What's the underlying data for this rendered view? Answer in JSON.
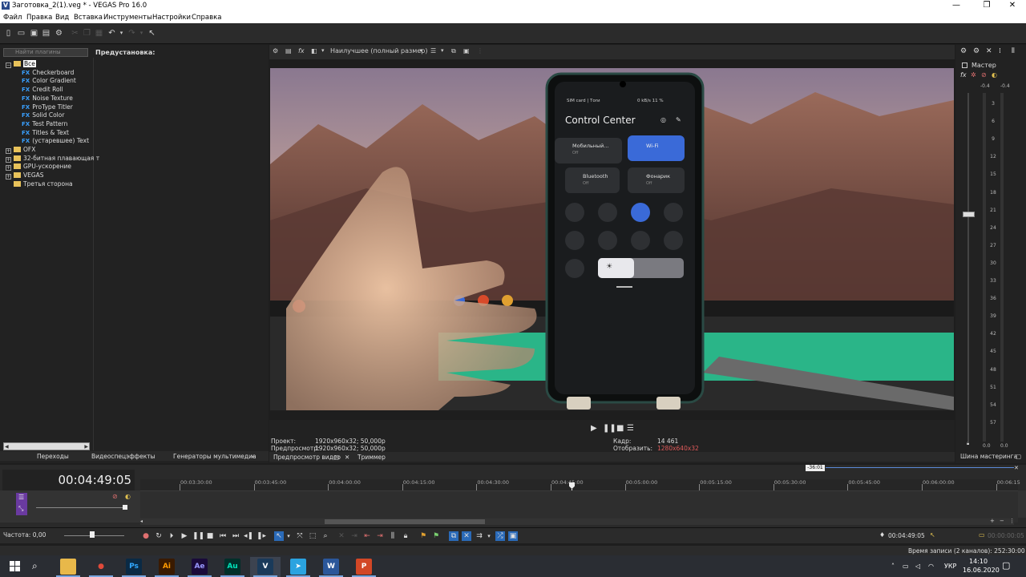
{
  "window": {
    "title": "Заготовка_2(1).veg * - VEGAS Pro 16.0",
    "minimize": "—",
    "maximize": "❐",
    "close": "✕"
  },
  "menu": [
    "Файл",
    "Правка",
    "Вид",
    "Вставка",
    "Инструменты",
    "Настройки",
    "Справка"
  ],
  "plugins": {
    "search_placeholder": "Найти плагины",
    "preset_label": "Предустановка:",
    "tree": [
      {
        "label": "Все",
        "type": "folder",
        "level": 0,
        "selected": true
      },
      {
        "label": "Checkerboard",
        "type": "fx",
        "level": 1
      },
      {
        "label": "Color Gradient",
        "type": "fx",
        "level": 1
      },
      {
        "label": "Credit Roll",
        "type": "fx",
        "level": 1
      },
      {
        "label": "Noise Texture",
        "type": "fx",
        "level": 1
      },
      {
        "label": "ProType Titler",
        "type": "fx",
        "level": 1
      },
      {
        "label": "Solid Color",
        "type": "fx",
        "level": 1
      },
      {
        "label": "Test Pattern",
        "type": "fx",
        "level": 1
      },
      {
        "label": "Titles & Text",
        "type": "fx",
        "level": 1
      },
      {
        "label": "(устаревшее) Text",
        "type": "fx",
        "level": 1
      },
      {
        "label": "OFX",
        "type": "folder",
        "level": 0
      },
      {
        "label": "32-битная плавающая т",
        "type": "folder",
        "level": 0
      },
      {
        "label": "GPU-ускорение",
        "type": "folder",
        "level": 0
      },
      {
        "label": "VEGAS",
        "type": "folder",
        "level": 0
      },
      {
        "label": "Третья сторона",
        "type": "folder",
        "level": 0,
        "noexpand": true
      }
    ],
    "fx_badge": "FX"
  },
  "left_tabs": [
    "Переходы",
    "Видеоспецэффекты",
    "Генераторы мультимедиа"
  ],
  "preview": {
    "quality": "Наилучшее (полный размер)",
    "project_label": "Проект:",
    "project_value": "1920x960x32; 50,000p",
    "preview_label": "Предпросмотр:",
    "preview_value": "1920x960x32; 50,000p",
    "frame_label": "Кадр:",
    "frame_value": "14 461",
    "display_label": "Отобразить:",
    "display_value": "1280x640x32",
    "tab_preview": "Предпросмотр видео",
    "tab_trimmer": "Триммер"
  },
  "phone": {
    "status_left": "SIM card | Тоrи",
    "status_right": "0 kB/s  11 %",
    "title": "Control Center",
    "tile_mobile": "Мобильный...",
    "tile_mobile_sub": "Off",
    "tile_wifi": "Wi-Fi",
    "tile_wifi_sub": "",
    "tile_bt": "Bluetooth",
    "tile_bt_sub": "Off",
    "tile_torch": "Фонарик",
    "tile_torch_sub": "Off",
    "brightness_icon": "☀"
  },
  "master": {
    "label": "Мастер",
    "peak_left": "-0.4",
    "peak_right": "-0.4",
    "scale": [
      "3",
      "6",
      "9",
      "12",
      "15",
      "18",
      "21",
      "24",
      "27",
      "30",
      "33",
      "36",
      "39",
      "42",
      "45",
      "48",
      "51",
      "54",
      "57"
    ],
    "bottom_left": "0.0",
    "bottom_right": "0.0",
    "tab": "Шина мастеринга"
  },
  "timeline": {
    "timecode": "00:04:49:05",
    "ruler": [
      "00:03:30:00",
      "00:03:45:00",
      "00:04:00:00",
      "00:04:15:00",
      "00:04:30:00",
      "00:04:45:00",
      "00:05:00:00",
      "00:05:15:00",
      "00:05:30:00",
      "00:05:45:00",
      "00:06:00:00",
      "00:06:15"
    ],
    "top_marker": "-36:01",
    "rate_label": "Частота: 0,00",
    "cursor_time": "00:04:49:05",
    "end_time": "00:00:00:05"
  },
  "status": {
    "record_time": "Время записи (2 каналов): 252:30:00"
  },
  "taskbar": {
    "lang": "УКР",
    "time": "14:10",
    "date": "16.06.2020",
    "apps": [
      {
        "name": "explorer",
        "glyph": "▬",
        "color": "#e8b84a",
        "fg": "#e8b84a"
      },
      {
        "name": "chrome",
        "glyph": "●",
        "color": "#2a2d33",
        "fg": "#e04a3a"
      },
      {
        "name": "photoshop",
        "glyph": "Ps",
        "color": "#0a2a45",
        "fg": "#31a8ff"
      },
      {
        "name": "illustrator",
        "glyph": "Ai",
        "color": "#3a1a00",
        "fg": "#ff9a00"
      },
      {
        "name": "after-effects",
        "glyph": "Ae",
        "color": "#1a0a3a",
        "fg": "#9999ff"
      },
      {
        "name": "audition",
        "glyph": "Au",
        "color": "#00302a",
        "fg": "#00e4bb"
      },
      {
        "name": "vegas",
        "glyph": "V",
        "color": "#1a3a5a",
        "fg": "#ffffff"
      },
      {
        "name": "telegram",
        "glyph": "➤",
        "color": "#2aa3e0",
        "fg": "#ffffff"
      },
      {
        "name": "word",
        "glyph": "W",
        "color": "#2b579a",
        "fg": "#ffffff"
      },
      {
        "name": "powerpoint",
        "glyph": "P",
        "color": "#d24726",
        "fg": "#ffffff"
      }
    ]
  }
}
